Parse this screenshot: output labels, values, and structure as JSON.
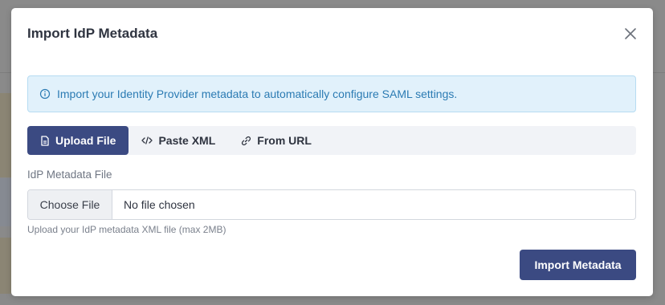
{
  "modal": {
    "title": "Import IdP Metadata",
    "close_icon": "close-icon"
  },
  "alert": {
    "icon": "info-icon",
    "text": "Import your Identity Provider metadata to automatically configure SAML settings."
  },
  "tabs": [
    {
      "label": "Upload File",
      "icon": "file-icon",
      "active": true
    },
    {
      "label": "Paste XML",
      "icon": "code-icon",
      "active": false
    },
    {
      "label": "From URL",
      "icon": "link-icon",
      "active": false
    }
  ],
  "upload": {
    "label": "IdP Metadata File",
    "choose_button": "Choose File",
    "status": "No file chosen",
    "help": "Upload your IdP metadata XML file (max 2MB)"
  },
  "actions": {
    "import_label": "Import Metadata"
  },
  "colors": {
    "primary": "#3b4a82",
    "alert_bg": "#e1f1fb",
    "alert_text": "#2b7bb3",
    "overlay": "#8a8a8a"
  }
}
